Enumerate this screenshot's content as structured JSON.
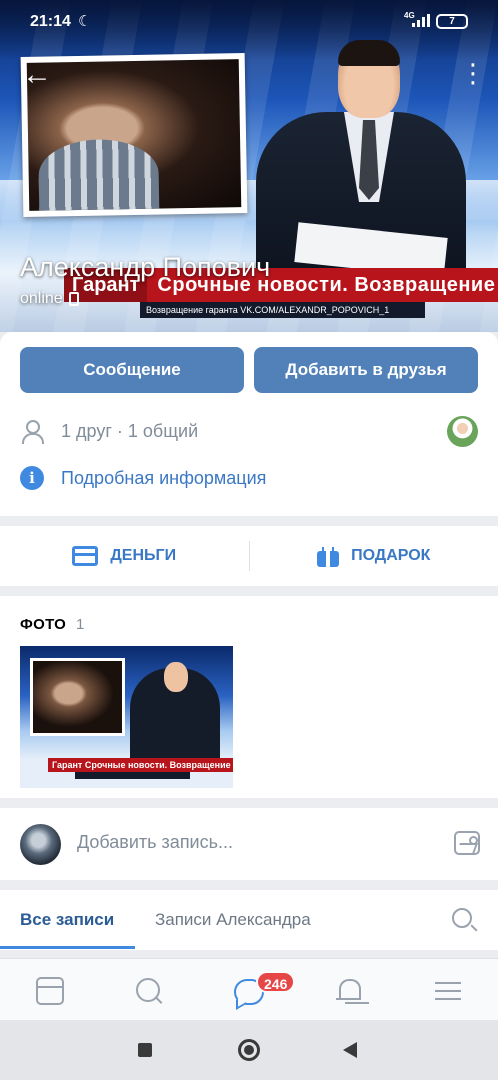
{
  "status_bar": {
    "time": "21:14",
    "network": "4G",
    "battery": "7"
  },
  "cover": {
    "news_tag": "Гарант",
    "news_headline": "Срочные новости. Возвращение",
    "news_subline": "Возвращение гаранта VK.COM/ALEXANDR_POPOVICH_1"
  },
  "profile": {
    "name": "Александр Попович",
    "status": "online"
  },
  "actions": {
    "message_label": "Сообщение",
    "add_friend_label": "Добавить в друзья"
  },
  "friends": {
    "text": "1 друг · 1 общий"
  },
  "info": {
    "label": "Подробная информация"
  },
  "quick_actions": {
    "money_label": "ДЕНЬГИ",
    "gift_label": "ПОДАРОК"
  },
  "photos": {
    "title": "ФОТО",
    "count": "1",
    "thumb_headline": "Срочные новости. Возвращение",
    "thumb_tag": "Гарант"
  },
  "composer": {
    "placeholder": "Добавить запись..."
  },
  "tabs": {
    "all": "Все записи",
    "author": "Записи Александра"
  },
  "bottom_nav": {
    "messages_badge": "246"
  },
  "colors": {
    "accent": "#5181b8",
    "link": "#3a78c5",
    "badge": "#e64646",
    "news_red": "#b8141c"
  }
}
